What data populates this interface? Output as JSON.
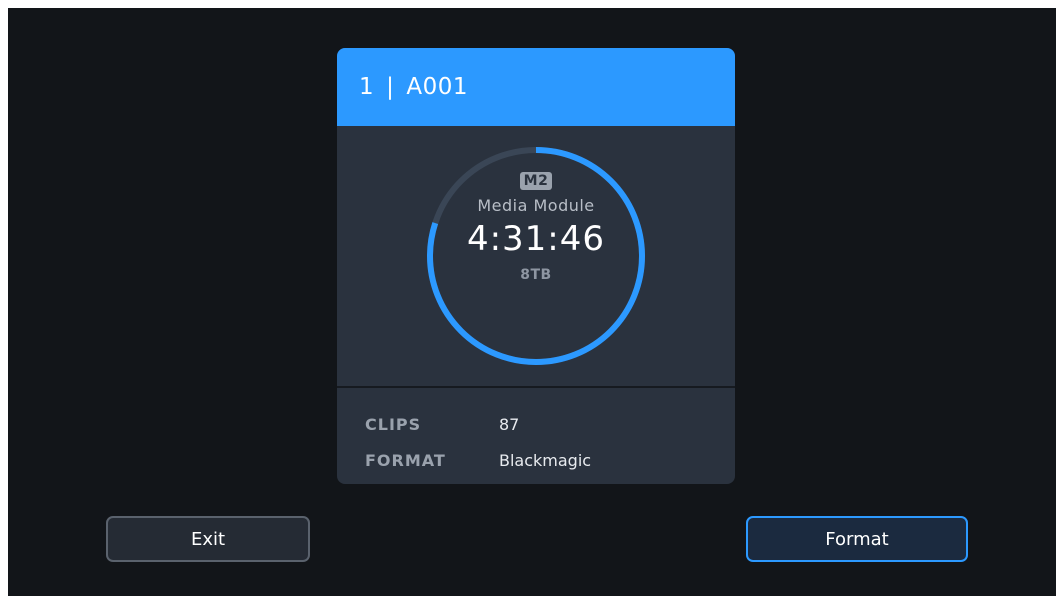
{
  "card": {
    "slot_number": "1",
    "separator": "|",
    "card_name": "A001",
    "media_badge": "M2",
    "media_label": "Media Module",
    "time_remaining": "4:31:46",
    "capacity": "8TB",
    "remaining_fraction": 0.8,
    "ring_colors": {
      "active": "#2c99ff",
      "track": "#3a4656"
    }
  },
  "info": {
    "clips_label": "CLIPS",
    "clips_value": "87",
    "format_label": "FORMAT",
    "format_value": "Blackmagic"
  },
  "buttons": {
    "exit_label": "Exit",
    "format_label": "Format"
  },
  "colors": {
    "background": "#121519",
    "card": "#2a323e",
    "accent": "#2c99ff"
  }
}
